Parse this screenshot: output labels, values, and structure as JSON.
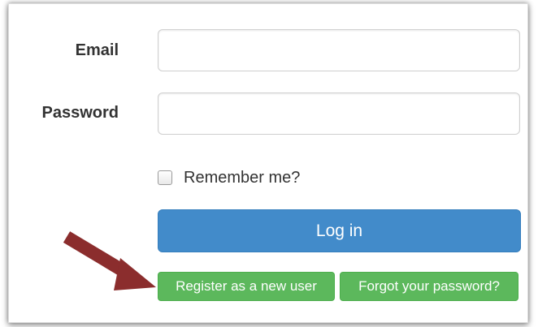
{
  "form": {
    "email_label": "Email",
    "email_value": "",
    "password_label": "Password",
    "password_value": "",
    "remember_label": "Remember me?",
    "remember_checked": false,
    "login_label": "Log in",
    "register_label": "Register as a new user",
    "forgot_label": "Forgot your password?"
  },
  "colors": {
    "primary": "#428bca",
    "success": "#5cb85c",
    "arrow": "#8b2d2d"
  },
  "icons": {
    "annotation_arrow": "arrow-icon"
  }
}
